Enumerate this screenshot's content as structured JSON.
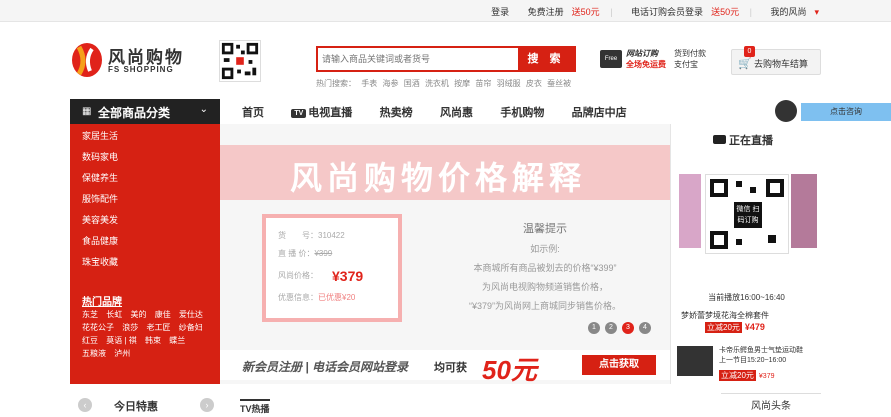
{
  "topbar": {
    "login": "登录",
    "register": "免费注册",
    "register_bonus": "送50元",
    "phone_login": "电话订购会员登录",
    "phone_bonus": "送50元",
    "my_account": "我的风尚"
  },
  "header": {
    "logo_name": "风尚购物",
    "logo_sub": "FS SHOPPING",
    "search_placeholder": "请输入商品关键词或者货号",
    "search_button": "搜 索",
    "hot_label": "热门搜索：",
    "hot_terms": [
      "手表",
      "海参",
      "国酒",
      "洗衣机",
      "按摩",
      "苗帘",
      "羽绒服",
      "皮衣",
      "蚕丝被"
    ],
    "promo_l1": "网站订购",
    "promo_l2": "全场免运费",
    "promo_r1": "货到付款",
    "promo_r2": "支付宝",
    "truck_text": "Free",
    "cart_count": "0",
    "cart_label": "去购物车结算"
  },
  "nav": {
    "all_categories": "全部商品分类",
    "items": [
      "首页",
      "电视直播",
      "热卖榜",
      "风尚惠",
      "手机购物",
      "品牌店中店"
    ],
    "tv_badge": "TV",
    "consult": "点击咨询"
  },
  "sidebar": {
    "categories": [
      "家居生活",
      "数码家电",
      "保健养生",
      "服饰配件",
      "美容美发",
      "食品健康",
      "珠宝收藏"
    ],
    "hot_brands_title": "热门品牌",
    "brands": [
      "东芝",
      "长虹",
      "美的",
      "康佳",
      "爱仕达",
      "花花公子",
      "浪莎",
      "老工匠",
      "纱备妇",
      "红豆",
      "莫语 | 祺",
      "韩束",
      "蝶兰",
      "五粮液",
      "泸州"
    ]
  },
  "banner": {
    "title": "风尚购物价格解释",
    "price_rows": [
      {
        "label": "货　　号：",
        "value": "310422"
      },
      {
        "label": "直 播 价：",
        "value": "¥399"
      },
      {
        "label": "风尚价格：",
        "value": "¥379"
      },
      {
        "label": "优惠信息：",
        "value": "已优惠¥20"
      }
    ],
    "tip_title": "温馨提示",
    "tip_lines": [
      "如示例:",
      "本商城所有商品被划去的价格“¥399”",
      "为风尚电视购物频道销售价格，",
      "“¥379”为风尚网上商城同步销售价格。"
    ],
    "pager": [
      "1",
      "2",
      "3",
      "4"
    ],
    "reg_a": "新会员注册",
    "reg_a2": "电话会员网站登录",
    "reg_b": "均可获",
    "reg_c": "50元",
    "reg_d": "点击获取"
  },
  "live": {
    "title": "正在直播",
    "qr_text": "微信\n扫码订购",
    "time": "当前播放16:00~16:40",
    "program": "梦娇蕾梦境花海全棉套件",
    "discount": "立减20元",
    "price": "¥479",
    "next_title": "卡帝乐鳄鱼男士气垫运动鞋",
    "next_time": "上一节目15:20~16:00",
    "next_discount": "立减20元",
    "next_price": "¥379"
  },
  "bottom": {
    "today": "今日特惠",
    "tv": "TV热播",
    "news": "风尚头条"
  }
}
